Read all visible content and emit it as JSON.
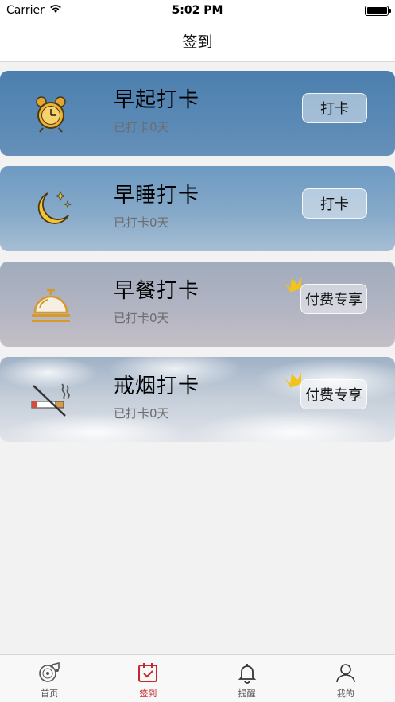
{
  "status_bar": {
    "carrier": "Carrier",
    "time": "5:02 PM"
  },
  "nav": {
    "title": "签到"
  },
  "cards": [
    {
      "title": "早起打卡",
      "subtitle": "已打卡0天",
      "button": "打卡",
      "icon": "alarm-clock-icon",
      "premium": false
    },
    {
      "title": "早睡打卡",
      "subtitle": "已打卡0天",
      "button": "打卡",
      "icon": "moon-stars-icon",
      "premium": false
    },
    {
      "title": "早餐打卡",
      "subtitle": "已打卡0天",
      "button": "付费专享",
      "icon": "service-bell-icon",
      "premium": true
    },
    {
      "title": "戒烟打卡",
      "subtitle": "已打卡0天",
      "button": "付费专享",
      "icon": "no-smoking-icon",
      "premium": true
    }
  ],
  "tabs": [
    {
      "label": "首页",
      "icon": "record-music-icon",
      "active": false
    },
    {
      "label": "签到",
      "icon": "calendar-check-icon",
      "active": true
    },
    {
      "label": "提醒",
      "icon": "bell-icon",
      "active": false
    },
    {
      "label": "我的",
      "icon": "user-icon",
      "active": false
    }
  ],
  "colors": {
    "accent": "#c6262e",
    "icon_gold": "#e2a72e"
  }
}
